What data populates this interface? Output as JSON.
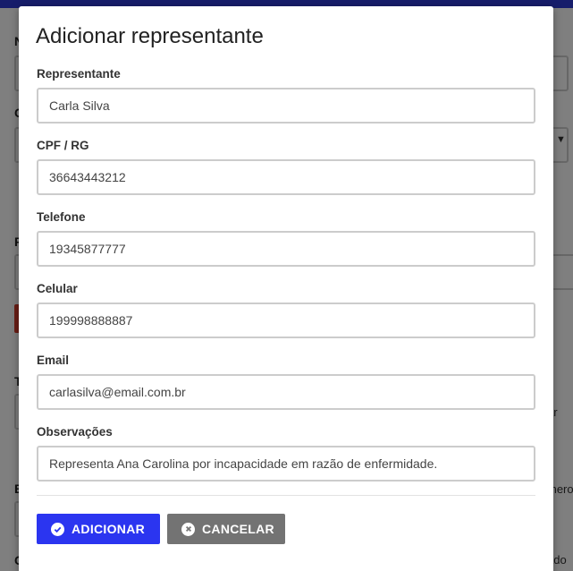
{
  "background": {
    "label_1": "N",
    "label_2": "C",
    "label_3": "F",
    "label_4": "T",
    "label_5": "E",
    "label_6": "C",
    "right_text_1": "ar",
    "right_text_2": "mero",
    "right_text_3": "ado"
  },
  "modal": {
    "title": "Adicionar representante",
    "fields": [
      {
        "label": "Representante",
        "value": "Carla Silva"
      },
      {
        "label": "CPF / RG",
        "value": "36643443212"
      },
      {
        "label": "Telefone",
        "value": "19345877777"
      },
      {
        "label": "Celular",
        "value": "199998888887"
      },
      {
        "label": "Email",
        "value": "carlasilva@email.com.br"
      },
      {
        "label": "Observações",
        "value": "Representa Ana Carolina por incapacidade em razão de enfermidade."
      }
    ],
    "buttons": {
      "add_label": "ADICIONAR",
      "cancel_label": "CANCELAR"
    }
  },
  "colors": {
    "primary": "#2b35f0",
    "secondary": "#737373",
    "topbar": "#2f3ad6",
    "danger": "#d23a2a"
  },
  "icons": {
    "add": "check-circle-icon",
    "cancel": "close-circle-icon"
  }
}
